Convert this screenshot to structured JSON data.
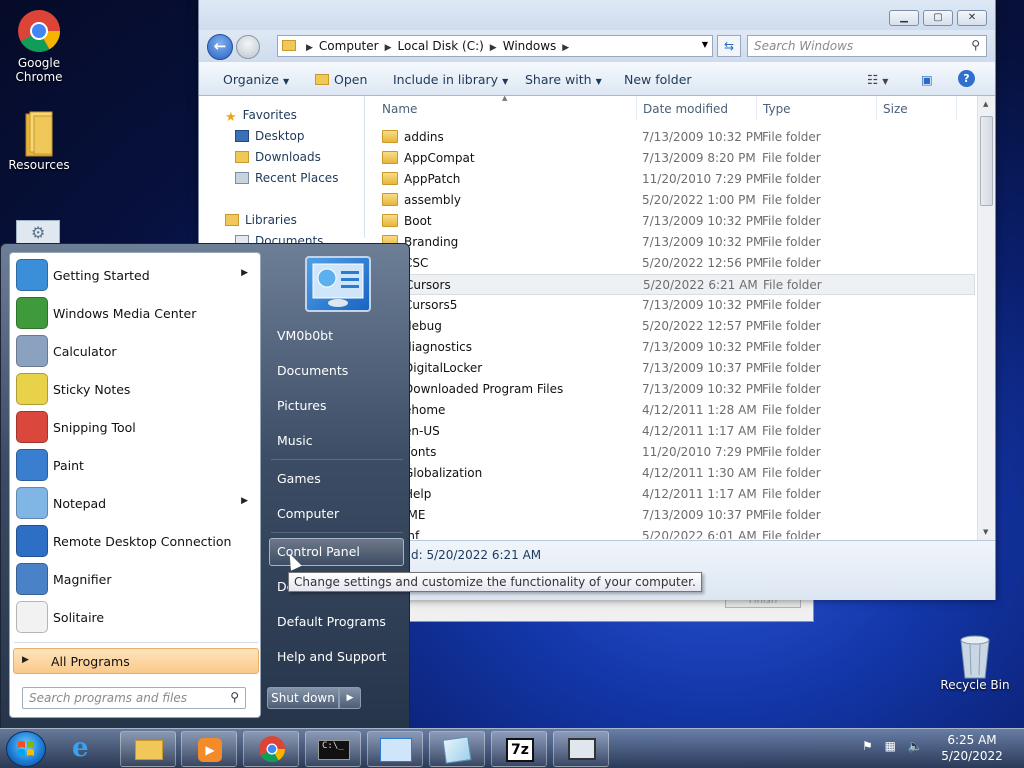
{
  "desktop": {
    "icons": [
      {
        "label_line1": "Google",
        "label_line2": "Chrome"
      },
      {
        "label_line1": "Resources",
        "label_line2": ""
      },
      {
        "label_line1": "Recycle Bin",
        "label_line2": ""
      }
    ]
  },
  "explorer": {
    "breadcrumb": [
      "Computer",
      "Local Disk (C:)",
      "Windows"
    ],
    "search_placeholder": "Search Windows",
    "toolbar": {
      "organize": "Organize",
      "open": "Open",
      "include_in_library": "Include in library",
      "share_with": "Share with",
      "new_folder": "New folder"
    },
    "navpane": {
      "favorites": "Favorites",
      "desktop": "Desktop",
      "downloads": "Downloads",
      "recent_places": "Recent Places",
      "libraries": "Libraries",
      "documents": "Documents"
    },
    "columns": {
      "name": "Name",
      "date": "Date modified",
      "type": "Type",
      "size": "Size"
    },
    "rows": [
      {
        "name": "addins",
        "date": "7/13/2009 10:32 PM",
        "type": "File folder"
      },
      {
        "name": "AppCompat",
        "date": "7/13/2009 8:20 PM",
        "type": "File folder"
      },
      {
        "name": "AppPatch",
        "date": "11/20/2010 7:29 PM",
        "type": "File folder"
      },
      {
        "name": "assembly",
        "date": "5/20/2022 1:00 PM",
        "type": "File folder"
      },
      {
        "name": "Boot",
        "date": "7/13/2009 10:32 PM",
        "type": "File folder"
      },
      {
        "name": "Branding",
        "date": "7/13/2009 10:32 PM",
        "type": "File folder"
      },
      {
        "name": "CSC",
        "date": "5/20/2022 12:56 PM",
        "type": "File folder"
      },
      {
        "name": "Cursors",
        "date": "5/20/2022 6:21 AM",
        "type": "File folder"
      },
      {
        "name": "Cursors5",
        "date": "7/13/2009 10:32 PM",
        "type": "File folder"
      },
      {
        "name": "debug",
        "date": "5/20/2022 12:57 PM",
        "type": "File folder"
      },
      {
        "name": "diagnostics",
        "date": "7/13/2009 10:32 PM",
        "type": "File folder"
      },
      {
        "name": "DigitalLocker",
        "date": "7/13/2009 10:37 PM",
        "type": "File folder"
      },
      {
        "name": "Downloaded Program Files",
        "date": "7/13/2009 10:32 PM",
        "type": "File folder"
      },
      {
        "name": "ehome",
        "date": "4/12/2011 1:28 AM",
        "type": "File folder"
      },
      {
        "name": "en-US",
        "date": "4/12/2011 1:17 AM",
        "type": "File folder"
      },
      {
        "name": "Fonts",
        "date": "11/20/2010 7:29 PM",
        "type": "File folder"
      },
      {
        "name": "Globalization",
        "date": "4/12/2011 1:30 AM",
        "type": "File folder"
      },
      {
        "name": "Help",
        "date": "4/12/2011 1:17 AM",
        "type": "File folder"
      },
      {
        "name": "IME",
        "date": "7/13/2009 10:37 PM",
        "type": "File folder"
      },
      {
        "name": "inf",
        "date": "5/20/2022 6:01 AM",
        "type": "File folder"
      }
    ],
    "details_text": "d: 5/20/2022 6:21 AM"
  },
  "dialog": {
    "finish": "Finish"
  },
  "startmenu": {
    "programs": [
      {
        "label": "Getting Started",
        "has_arrow": true,
        "color": "#3b8fd8"
      },
      {
        "label": "Windows Media Center",
        "has_arrow": false,
        "color": "#3e9a3a"
      },
      {
        "label": "Calculator",
        "has_arrow": false,
        "color": "#8aa2bf"
      },
      {
        "label": "Sticky Notes",
        "has_arrow": false,
        "color": "#e8d24a"
      },
      {
        "label": "Snipping Tool",
        "has_arrow": false,
        "color": "#d9473d"
      },
      {
        "label": "Paint",
        "has_arrow": false,
        "color": "#3a7ed0"
      },
      {
        "label": "Notepad",
        "has_arrow": true,
        "color": "#7fb6e6"
      },
      {
        "label": "Remote Desktop Connection",
        "has_arrow": false,
        "color": "#2d6fc5"
      },
      {
        "label": "Magnifier",
        "has_arrow": false,
        "color": "#4a82c8"
      },
      {
        "label": "Solitaire",
        "has_arrow": false,
        "color": "#f2f2f2"
      }
    ],
    "all_programs": "All Programs",
    "search_placeholder": "Search programs and files",
    "right_links": {
      "user": "VM0b0bt",
      "documents": "Documents",
      "pictures": "Pictures",
      "music": "Music",
      "games": "Games",
      "computer": "Computer",
      "control_panel": "Control Panel",
      "devices": "De",
      "default_programs": "Default Programs",
      "help_support": "Help and Support"
    },
    "shutdown": "Shut down"
  },
  "tooltip": "Change settings and customize the functionality of your computer.",
  "taskbar": {
    "clock_time": "6:25 AM",
    "clock_date": "5/20/2022",
    "sevenzip_label": "7z"
  }
}
